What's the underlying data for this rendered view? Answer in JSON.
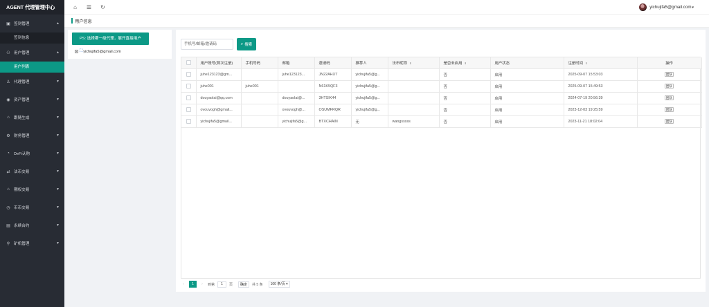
{
  "brand": "AGENT 代理管理中心",
  "sidebar": {
    "groups": [
      {
        "label": "签到管理",
        "icon": "calendar-icon",
        "arrow": "▲"
      },
      {
        "sub": "签到信息"
      },
      {
        "label": "用户管理",
        "icon": "user-group-icon",
        "arrow": "▲"
      },
      {
        "sub": "用户列表"
      },
      {
        "label": "代理管理",
        "icon": "person-icon",
        "arrow": "▼"
      },
      {
        "label": "资产管理",
        "icon": "coin-icon",
        "arrow": "▼"
      },
      {
        "label": "跟随生成",
        "icon": "home-icon",
        "arrow": "▼"
      },
      {
        "label": "财务管理",
        "icon": "gear-icon",
        "arrow": "▼"
      },
      {
        "label": "DeFi认购",
        "icon": "chart-icon",
        "arrow": "▼"
      },
      {
        "label": "法币交易",
        "icon": "exchange-icon",
        "arrow": "▼"
      },
      {
        "label": "期权交易",
        "icon": "home-icon",
        "arrow": "▼"
      },
      {
        "label": "币币交易",
        "icon": "clock-icon",
        "arrow": "▼"
      },
      {
        "label": "永续合约",
        "icon": "document-icon",
        "arrow": "▼"
      },
      {
        "label": "矿机管理",
        "icon": "link-icon",
        "arrow": "▼"
      }
    ]
  },
  "topbar": {
    "user_email": "yichujifa5@gmail.com",
    "caret": "▾"
  },
  "breadcrumb": {
    "title": "用户信息"
  },
  "left_panel": {
    "ps_text": "PS: 选择哪一级代理，展开直接用户",
    "tree_toggle": "+",
    "tree_root": "yichujifa5@gmail.com"
  },
  "search": {
    "placeholder": "手机号/邮箱/邀请码",
    "button": "搜索"
  },
  "table": {
    "headers": [
      "用户账号(首次注册)",
      "手机号码",
      "邮箱",
      "邀请码",
      "推荐人",
      "法币昵称",
      "是否未启用",
      "用户状态",
      "注册时间",
      "操作"
    ],
    "rows": [
      [
        "juhe123123@gm...",
        "",
        "juhe123123...",
        "JN22AHXT",
        "yichujifa5@g...",
        "",
        "否",
        "启用",
        "2025-09-07 15:53:03",
        "团队"
      ],
      [
        "juhe001",
        "juhe001",
        "",
        "N61K5QF3",
        "yichujifa5@g...",
        "",
        "否",
        "启用",
        "2025-09-07 15:49:53",
        "团队"
      ],
      [
        "douyaolai@qq.com",
        "",
        "douyaolai@...",
        "3HTSIK44",
        "yichujifa5@g...",
        "",
        "否",
        "启用",
        "2024-07-19 20:56:39",
        "团队"
      ],
      [
        "ovouvogh@gmail...",
        "",
        "ovouvogh@...",
        "OSUMFRQR",
        "yichujifa5@g...",
        "",
        "否",
        "启用",
        "2023-12-03 19:25:59",
        "团队"
      ],
      [
        "yichujifa5@gmail...",
        "",
        "yichujifa5@g...",
        "BTXCHAIN",
        "无",
        "wangsssss",
        "否",
        "启用",
        "2023-11-21 18:02:04",
        "团队"
      ]
    ]
  },
  "pager": {
    "current": "1",
    "goto_label": "到第",
    "goto_value": "1",
    "page_unit": "页",
    "confirm": "确定",
    "total": "共 5 条",
    "page_size": "100 条/页 ▾"
  }
}
